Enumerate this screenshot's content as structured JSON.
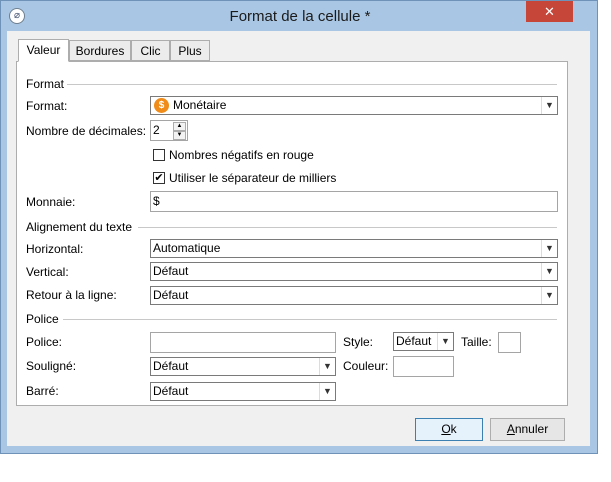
{
  "window": {
    "title": "Format de la cellule *",
    "close_glyph": "✕",
    "app_icon_glyph": "⌀"
  },
  "tabs": [
    {
      "label": "Valeur",
      "active": true
    },
    {
      "label": "Bordures",
      "active": false
    },
    {
      "label": "Clic",
      "active": false
    },
    {
      "label": "Plus",
      "active": false
    }
  ],
  "format_section": {
    "title": "Format",
    "format_label": "Format:",
    "format_value": "Monétaire",
    "format_icon_glyph": "$",
    "decimals_label": "Nombre de décimales:",
    "decimals_value": "2",
    "negatives_red_label": "Nombres négatifs en rouge",
    "negatives_red_checked": false,
    "thousands_sep_label": "Utiliser le séparateur de milliers",
    "thousands_sep_checked": true,
    "currency_label": "Monnaie:",
    "currency_value": "$"
  },
  "alignment_section": {
    "title": "Alignement du texte",
    "horizontal_label": "Horizontal:",
    "horizontal_value": "Automatique",
    "vertical_label": "Vertical:",
    "vertical_value": "Défaut",
    "wrap_label": "Retour à la ligne:",
    "wrap_value": "Défaut"
  },
  "font_section": {
    "title": "Police",
    "font_label": "Police:",
    "font_value": "",
    "style_label": "Style:",
    "style_value": "Défaut",
    "size_label": "Taille:",
    "size_value": "",
    "underline_label": "Souligné:",
    "underline_value": "Défaut",
    "color_label": "Couleur:",
    "color_value": "",
    "strike_label": "Barré:",
    "strike_value": "Défaut"
  },
  "buttons": {
    "ok_underlined": "O",
    "ok_rest": "k",
    "cancel_underlined": "A",
    "cancel_rest": "nnuler"
  },
  "glyphs": {
    "dropdown": "▼",
    "spin_up": "▲",
    "spin_down": "▼",
    "check": "✔"
  },
  "colors": {
    "titlebar": "#a9c7e4",
    "close": "#c7463a",
    "currency_icon": "#f08c1a"
  }
}
